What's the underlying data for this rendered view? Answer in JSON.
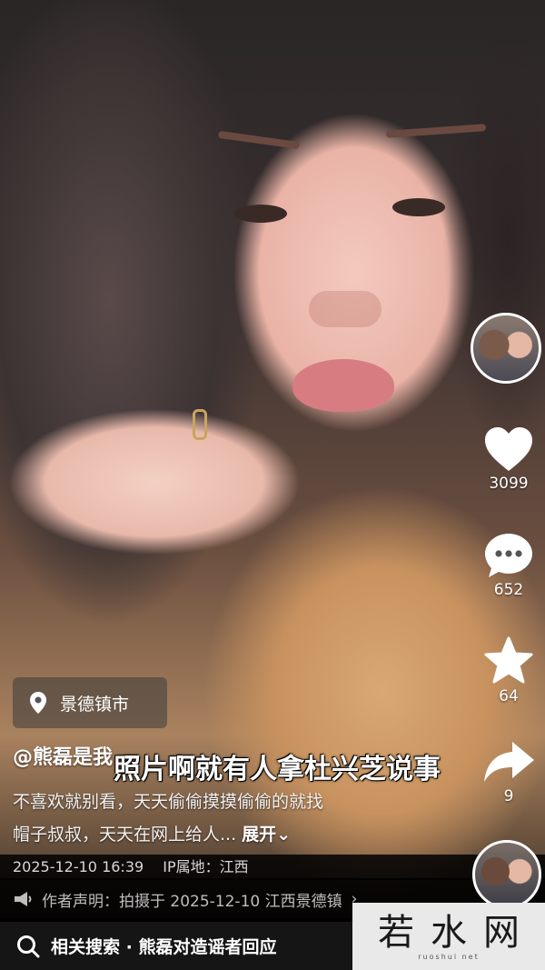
{
  "video": {
    "location": "景德镇市",
    "username": "@熊磊是我",
    "subtitle": "照片啊就有人拿杜兴芝说事",
    "description_line1": "不喜欢就别看，天天偷偷摸摸偷偷的就找",
    "description_line2": "帽子叔叔，天天在网上给人...",
    "expand_label": "展开"
  },
  "actions": {
    "likes": "3099",
    "comments": "652",
    "favorites": "64",
    "shares": "9"
  },
  "meta": {
    "timestamp": "2025-12-10 16:39",
    "ip_location": "IP属地：江西",
    "declaration": "作者声明：拍摄于 2025-12-10 江西景德镇"
  },
  "search_bar": {
    "text": "相关搜索 · 熊磊对造谣者回应"
  },
  "watermark": {
    "title": "若水网",
    "sub": "ruoshui net"
  }
}
